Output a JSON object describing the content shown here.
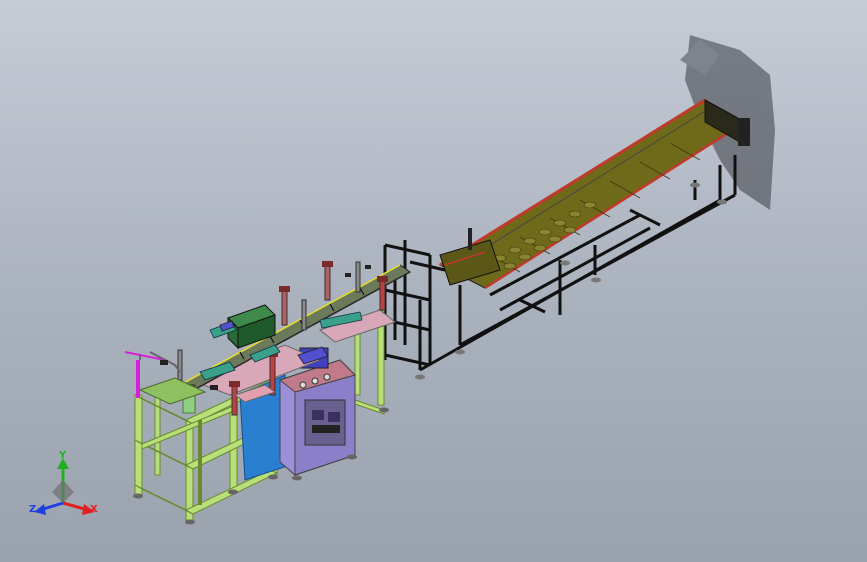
{
  "triad": {
    "x_label": "X",
    "y_label": "Y",
    "z_label": "Z",
    "colors": {
      "x": "#e02020",
      "y": "#20b020",
      "z": "#2040e0"
    }
  },
  "colors": {
    "background_top": "#c6ccd6",
    "background_bottom": "#9aa2ae",
    "frame_green": "#b8e07a",
    "frame_black": "#111111",
    "cabinet_purple": "#9a8fd8",
    "cabinet_blue": "#2a7fd0",
    "conveyor_olive": "#6f6a1a",
    "rail_red": "#c0392b",
    "accent_magenta": "#d61fd6"
  }
}
